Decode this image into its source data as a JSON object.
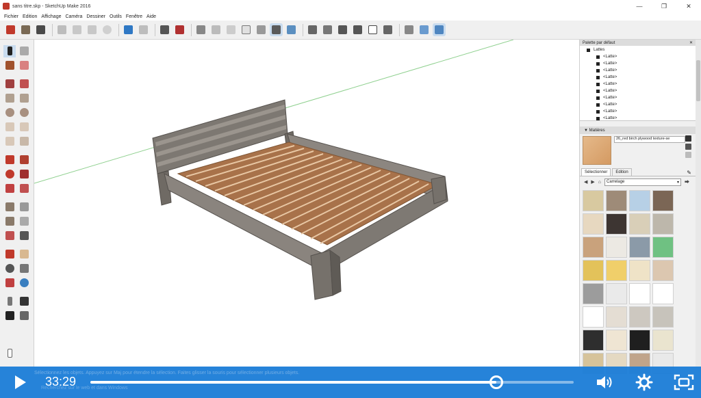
{
  "window": {
    "title": "sans titre.skp - SketchUp Make 2016",
    "minimize": "—",
    "maximize": "❐",
    "close": "✕"
  },
  "menu": [
    "Fichier",
    "Edition",
    "Affichage",
    "Caméra",
    "Dessiner",
    "Outils",
    "Fenêtre",
    "Aide"
  ],
  "outliner": {
    "header": "Palette par défaut",
    "root": "Lattes",
    "items": [
      "<Latte>",
      "<Latte>",
      "<Latte>",
      "<Latte>",
      "<Latte>",
      "<Latte>",
      "<Latte>",
      "<Latte>",
      "<Latte>",
      "<Latte>"
    ]
  },
  "materials": {
    "header": "Matières",
    "current_name": "26_red birch plywood texture-se",
    "tabs": [
      "Sélectionner",
      "Edition"
    ],
    "collection": "Carrelage",
    "swatch_colors": [
      "#d8c9a0",
      "#9e8b78",
      "#b7d0e6",
      "#7b6655",
      "#e7d8c0",
      "#3d3532",
      "#d9cfb8",
      "#bdb7ab",
      "#c9a27c",
      "#ece9e3",
      "#8b9aa8",
      "#6fc182",
      "#e3c25a",
      "#f0cf6a",
      "#efe3c7",
      "#dcc7b0",
      "#9c9c9c",
      "#eaeaea",
      "#ffffff",
      "#ffffff",
      "#ffffff",
      "#e4ddd3",
      "#cdc8c0",
      "#c7c3bb",
      "#2e2e2e",
      "#efe5d3",
      "#1f1f1f",
      "#eae4cf",
      "#d6c39a",
      "#e4d9c2",
      "#c0a48a",
      "#e9e9e9"
    ]
  },
  "video": {
    "time": "33:29",
    "progress": 0.84,
    "ghost_status": "Sélectionnez les objets. Appuyez sur Maj pour étendre la sélection. Faites glisser la souris pour sélectionner plusieurs objets.",
    "ghost_taskbar": "Recherchez sur le web et dans Windows"
  }
}
